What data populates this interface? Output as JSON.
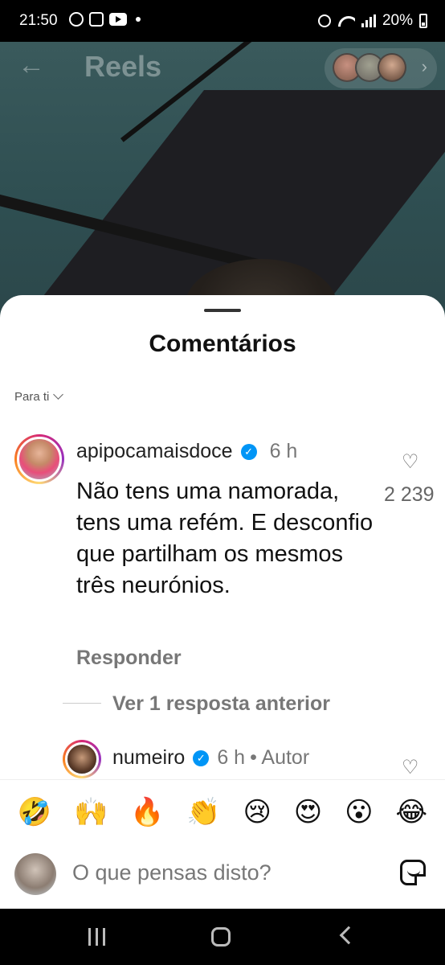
{
  "status_bar": {
    "time": "21:50",
    "battery": "20%"
  },
  "header": {
    "title": "Reels"
  },
  "comments_sheet": {
    "title": "Comentários",
    "sort_label": "Para ti",
    "comments": [
      {
        "username": "apipocamaisdoce",
        "verified": true,
        "time": "6 h",
        "text": "Não tens uma namorada, tens uma refém. E desconfio que partilham os mesmos três neurónios.",
        "likes": "2 239",
        "reply_label": "Responder",
        "view_replies_label": "Ver 1 resposta anterior"
      },
      {
        "username": "numeiro",
        "verified": true,
        "time": "6 h",
        "author_tag": "• Autor"
      }
    ],
    "emoji_reactions": [
      "🤣",
      "🙌",
      "🔥",
      "👏",
      "😢",
      "😍",
      "😮",
      "😂"
    ],
    "input": {
      "placeholder": "O que pensas disto?"
    }
  },
  "icons": {
    "back": "arrow-left-icon",
    "verified": "verified-badge-icon",
    "heart": "heart-outline-icon",
    "sticker": "sticker-icon"
  }
}
